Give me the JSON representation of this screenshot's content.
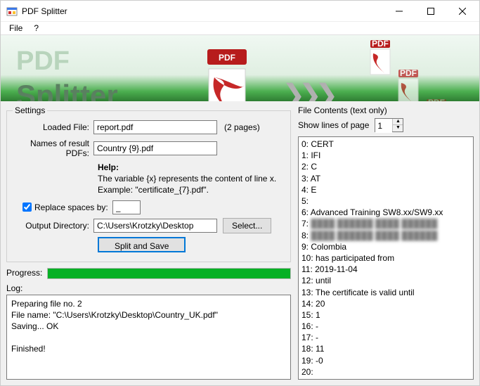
{
  "window": {
    "title": "PDF Splitter",
    "menu": {
      "file": "File",
      "help": "?"
    },
    "banner": {
      "line1": "PDF",
      "line2": "Splitter"
    }
  },
  "settings": {
    "legend": "Settings",
    "loaded_file_label": "Loaded File:",
    "loaded_file_value": "report.pdf",
    "pages_note": "(2 pages)",
    "result_names_label": "Names of result PDFs:",
    "result_names_value": "Country {9}.pdf",
    "help_title": "Help:",
    "help_line1": "The variable {x} represents the content of line x.",
    "help_line2": "Example: \"certificate_{7}.pdf\".",
    "replace_spaces_label": "Replace spaces by:",
    "replace_spaces_checked": true,
    "replace_spaces_value": "_",
    "output_dir_label": "Output Directory:",
    "output_dir_value": "C:\\Users\\Krotzky\\Desktop",
    "select_btn": "Select...",
    "split_btn": "Split and Save"
  },
  "progress": {
    "label": "Progress:",
    "percent": 100
  },
  "log": {
    "label": "Log:",
    "lines": [
      "Preparing file no. 2",
      "File name: \"C:\\Users\\Krotzky\\Desktop\\Country_UK.pdf\"",
      "Saving... OK",
      "",
      "Finished!"
    ]
  },
  "file_contents": {
    "header": "File Contents (text only)",
    "show_lines_label": "Show lines of page",
    "page_value": "1",
    "lines": [
      {
        "n": 0,
        "t": "CERT"
      },
      {
        "n": 1,
        "t": "IFI"
      },
      {
        "n": 2,
        "t": "C"
      },
      {
        "n": 3,
        "t": "AT"
      },
      {
        "n": 4,
        "t": "E"
      },
      {
        "n": 5,
        "t": ""
      },
      {
        "n": 6,
        "t": "Advanced Training SW8.xx/SW9.xx"
      },
      {
        "n": 7,
        "t": "",
        "blur": true
      },
      {
        "n": 8,
        "t": "",
        "blur": true
      },
      {
        "n": 9,
        "t": "Colombia"
      },
      {
        "n": 10,
        "t": " has participated from"
      },
      {
        "n": 11,
        "t": " 2019-11-04"
      },
      {
        "n": 12,
        "t": " until"
      },
      {
        "n": 13,
        "t": " The certificate is valid until"
      },
      {
        "n": 14,
        "t": " 20"
      },
      {
        "n": 15,
        "t": " 1"
      },
      {
        "n": 16,
        "t": " -"
      },
      {
        "n": 17,
        "t": " -"
      },
      {
        "n": 18,
        "t": " 11"
      },
      {
        "n": 19,
        "t": " -0"
      },
      {
        "n": 20,
        "t": ""
      }
    ]
  }
}
